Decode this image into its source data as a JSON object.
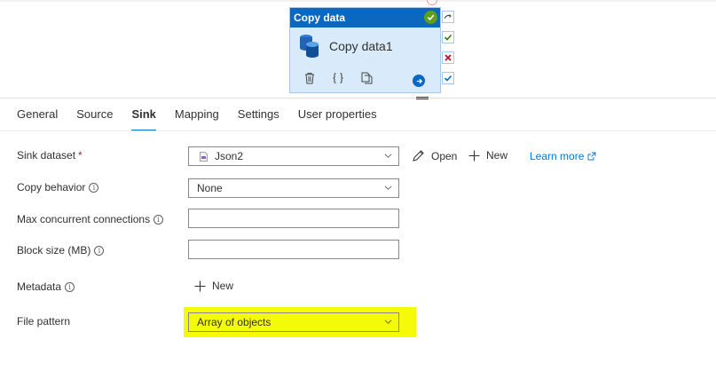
{
  "activity": {
    "type_label": "Copy data",
    "name": "Copy data1"
  },
  "tabs": [
    {
      "label": "General",
      "active": false
    },
    {
      "label": "Source",
      "active": false
    },
    {
      "label": "Sink",
      "active": true
    },
    {
      "label": "Mapping",
      "active": false
    },
    {
      "label": "Settings",
      "active": false
    },
    {
      "label": "User properties",
      "active": false
    }
  ],
  "form": {
    "sink_dataset": {
      "label": "Sink dataset",
      "required_mark": "*",
      "value": "Json2"
    },
    "copy_behavior": {
      "label": "Copy behavior",
      "value": "None"
    },
    "max_concurrent": {
      "label": "Max concurrent connections",
      "value": ""
    },
    "block_size": {
      "label": "Block size (MB)",
      "value": ""
    },
    "metadata": {
      "label": "Metadata",
      "new_label": "New"
    },
    "file_pattern": {
      "label": "File pattern",
      "value": "Array of objects"
    }
  },
  "actions": {
    "open_label": "Open",
    "new_label": "New",
    "learn_more_label": "Learn more"
  },
  "colors": {
    "accent": "#0078d4",
    "activity_header": "#0a68c0",
    "highlight": "#f5fa09",
    "success": "#5ea01a",
    "error": "#c50f1f"
  },
  "icons": {
    "info": "i"
  }
}
